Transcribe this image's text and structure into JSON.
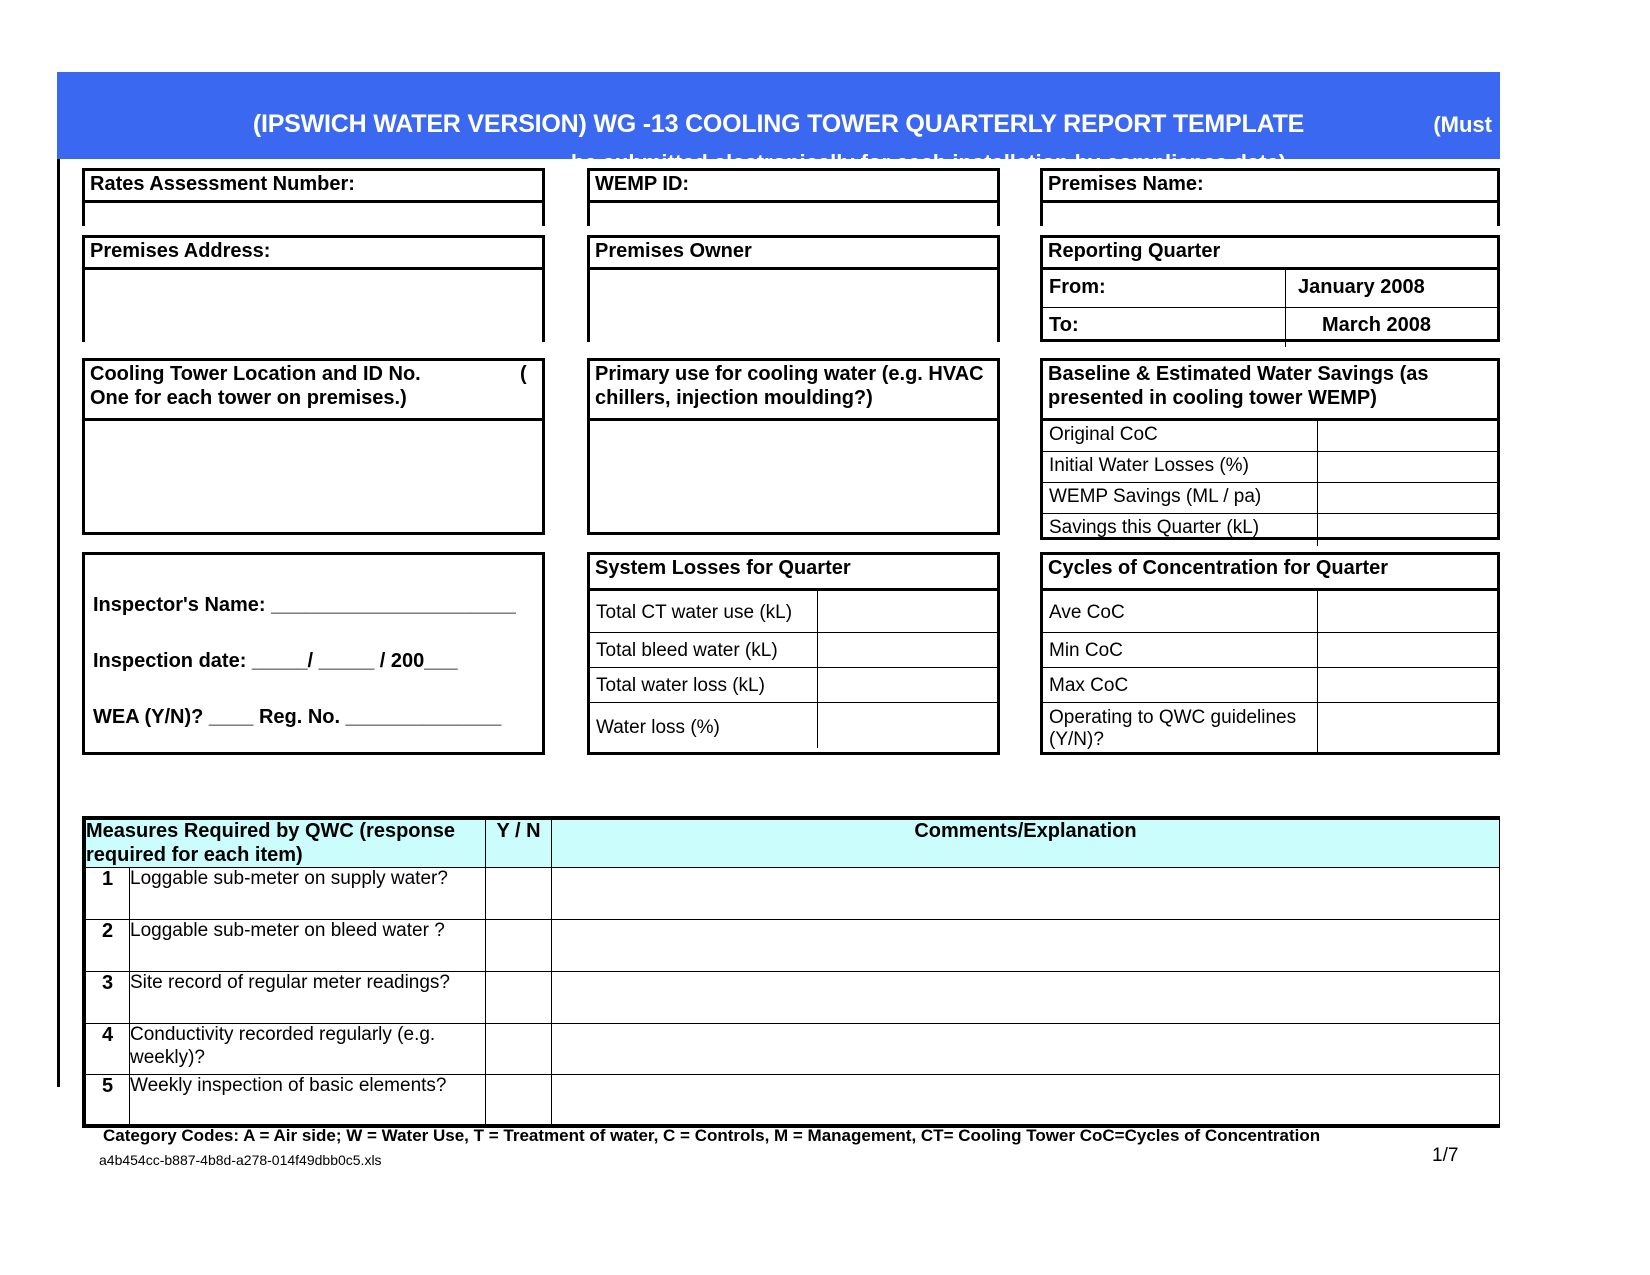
{
  "banner": {
    "title": "(IPSWICH WATER VERSION) WG -13 COOLING TOWER QUARTERLY REPORT TEMPLATE",
    "must": "(Must",
    "subtitle": "be submitted electronically for each installation by compliance date)",
    "background_color": "#3b68f0",
    "text_color": "#ffffff"
  },
  "fields": {
    "rates_assessment_number": {
      "label": "Rates Assessment Number:",
      "value": ""
    },
    "wemp_id": {
      "label": "WEMP ID:",
      "value": ""
    },
    "premises_name": {
      "label": "Premises Name:",
      "value": ""
    },
    "premises_address": {
      "label": "Premises Address:",
      "value": ""
    },
    "premises_owner": {
      "label": "Premises Owner",
      "value": ""
    },
    "cooling_tower_location": {
      "label": "Cooling Tower Location and ID No.                    (\nOne for each tower on premises.)",
      "line1": "Cooling Tower Location and ID No.",
      "paren": "(",
      "line2": "One for each tower on premises.)",
      "value": ""
    },
    "primary_use": {
      "line1": "Primary use for cooling water (e.g. HVAC",
      "line2": "chillers, injection moulding?)",
      "value": ""
    }
  },
  "reporting_quarter": {
    "title": "Reporting Quarter",
    "rows": [
      {
        "label": "From:",
        "value": "January 2008"
      },
      {
        "label": "To:",
        "value": "March 2008"
      }
    ]
  },
  "baseline_savings": {
    "title_line1": "Baseline & Estimated Water Savings (as",
    "title_line2": "presented in cooling tower WEMP)",
    "rows": [
      {
        "label": "Original CoC",
        "value": ""
      },
      {
        "label": "Initial Water Losses (%)",
        "value": ""
      },
      {
        "label": "WEMP Savings (ML / pa)",
        "value": ""
      },
      {
        "label": "Savings this Quarter (kL)",
        "value": ""
      }
    ]
  },
  "system_losses": {
    "title": "System Losses for Quarter",
    "rows": [
      {
        "label": "Total CT water use (kL)",
        "value": ""
      },
      {
        "label": "Total bleed water (kL)",
        "value": ""
      },
      {
        "label": "Total water loss (kL)",
        "value": ""
      },
      {
        "label": "Water loss (%)",
        "value": ""
      }
    ]
  },
  "cycles_of_concentration": {
    "title": "Cycles of Concentration for Quarter",
    "rows": [
      {
        "label": "Ave CoC",
        "value": ""
      },
      {
        "label": "Min CoC",
        "value": ""
      },
      {
        "label": "Max CoC",
        "value": ""
      },
      {
        "label": "Operating to QWC guidelines (Y/N)?",
        "label_line1": "Operating to QWC guidelines",
        "label_line2": "(Y/N)?",
        "value": ""
      }
    ]
  },
  "inspector": {
    "name_line": "Inspector's Name: ______________________",
    "date_line": "Inspection date: _____/ _____ / 200___",
    "wea_line": "WEA (Y/N)? ____     Reg. No. ______________"
  },
  "measures": {
    "header_left_line1": "Measures Required by QWC (response",
    "header_left_line2": "required for each item)",
    "header_yn": "Y / N",
    "header_comments": "Comments/Explanation",
    "header_bg": "#ccfdfd",
    "rows": [
      {
        "num": "1",
        "question": "Loggable sub-meter on supply water?",
        "yn": "",
        "comment": ""
      },
      {
        "num": "2",
        "question": "Loggable sub-meter on bleed water ?",
        "yn": "",
        "comment": ""
      },
      {
        "num": "3",
        "question": "Site record of regular meter readings?",
        "yn": "",
        "comment": ""
      },
      {
        "num": "4",
        "question": "Conductivity recorded regularly (e.g. weekly)?",
        "yn": "",
        "comment": ""
      },
      {
        "num": "5",
        "question": "Weekly inspection of basic elements?",
        "yn": "",
        "comment": ""
      }
    ]
  },
  "footer": {
    "category_codes": "Category Codes: A = Air side; W = Water Use, T = Treatment of water, C = Controls, M = Management, CT= Cooling Tower CoC=Cycles of Concentration",
    "filename": "a4b454cc-b887-4b8d-a278-014f49dbb0c5.xls",
    "page": "1/7"
  }
}
